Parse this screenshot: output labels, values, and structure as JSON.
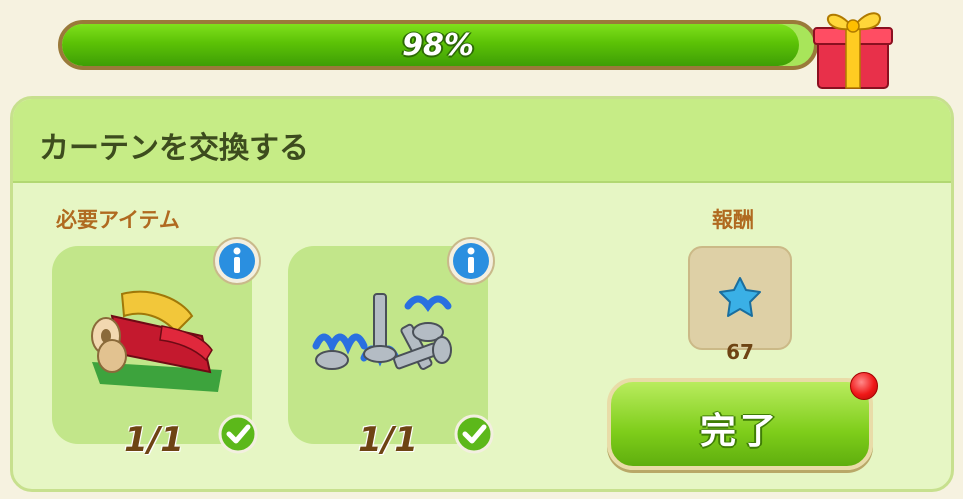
{
  "progress": {
    "label": "98%",
    "value": 0.98
  },
  "task": {
    "title": "カーテンを交換する"
  },
  "required": {
    "label": "必要アイテム",
    "items": [
      {
        "icon": "fabric-rolls-icon",
        "count": "1/1",
        "complete": true
      },
      {
        "icon": "bolts-and-springs-icon",
        "count": "1/1",
        "complete": true
      }
    ]
  },
  "reward": {
    "label": "報酬",
    "icon": "blue-star-icon",
    "count": "67"
  },
  "complete_button": {
    "label": "完了",
    "has_notification": true
  },
  "colors": {
    "progress": "#5cc206",
    "panel": "#e6f6c4",
    "header": "#c6ec86",
    "button": "#7ecd1a"
  }
}
